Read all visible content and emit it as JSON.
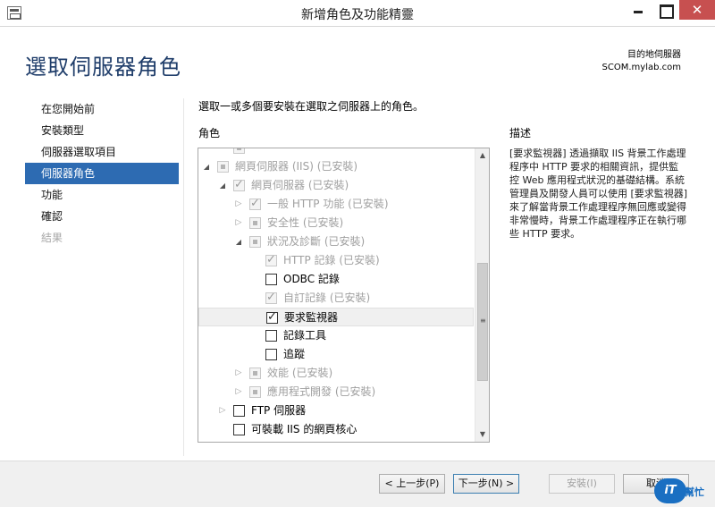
{
  "window": {
    "title": "新增角色及功能精靈",
    "close_glyph": "✕"
  },
  "header": {
    "title": "選取伺服器角色",
    "destination_label": "目的地伺服器",
    "destination_server": "SCOM.mylab.com"
  },
  "nav": {
    "items": [
      {
        "label": "在您開始前",
        "state": "normal"
      },
      {
        "label": "安裝類型",
        "state": "normal"
      },
      {
        "label": "伺服器選取項目",
        "state": "normal"
      },
      {
        "label": "伺服器角色",
        "state": "active"
      },
      {
        "label": "功能",
        "state": "normal"
      },
      {
        "label": "確認",
        "state": "normal"
      },
      {
        "label": "結果",
        "state": "disabled"
      }
    ]
  },
  "main": {
    "instruction": "選取一或多個要安裝在選取之伺服器上的角色。",
    "roles_header": "角色",
    "description_header": "描述",
    "description": "[要求監視器] 透過擷取 IIS 背景工作處理程序中 HTTP 要求的相關資訊，提供監控 Web 應用程式狀況的基礎結構。系統管理員及開發人員可以使用 [要求監視器] 來了解當背景工作處理程序無回應或變得非常慢時，背景工作處理程序正在執行哪些 HTTP 要求。"
  },
  "tree": {
    "rows": [
      {
        "label": "",
        "indent": 1,
        "expander": "none",
        "check": "partial",
        "disabled": true
      },
      {
        "label": "網頁伺服器 (IIS) (已安裝)",
        "indent": 0,
        "expander": "expanded",
        "check": "partial",
        "disabled": true
      },
      {
        "label": "網頁伺服器 (已安裝)",
        "indent": 1,
        "expander": "expanded",
        "check": "checked",
        "disabled": true
      },
      {
        "label": "一般 HTTP 功能 (已安裝)",
        "indent": 2,
        "expander": "collapsed",
        "check": "checked",
        "disabled": true
      },
      {
        "label": "安全性 (已安裝)",
        "indent": 2,
        "expander": "collapsed",
        "check": "partial",
        "disabled": true
      },
      {
        "label": "狀況及診斷 (已安裝)",
        "indent": 2,
        "expander": "expanded",
        "check": "partial",
        "disabled": true
      },
      {
        "label": "HTTP 記錄 (已安裝)",
        "indent": 3,
        "expander": "none",
        "check": "checked",
        "disabled": true
      },
      {
        "label": "ODBC 記錄",
        "indent": 3,
        "expander": "none",
        "check": "unchecked",
        "disabled": false
      },
      {
        "label": "自訂記錄 (已安裝)",
        "indent": 3,
        "expander": "none",
        "check": "checked",
        "disabled": true
      },
      {
        "label": "要求監視器",
        "indent": 3,
        "expander": "none",
        "check": "checked",
        "disabled": false,
        "selected": true
      },
      {
        "label": "記錄工具",
        "indent": 3,
        "expander": "none",
        "check": "unchecked",
        "disabled": false
      },
      {
        "label": "追蹤",
        "indent": 3,
        "expander": "none",
        "check": "unchecked",
        "disabled": false
      },
      {
        "label": "效能 (已安裝)",
        "indent": 2,
        "expander": "collapsed",
        "check": "partial",
        "disabled": true
      },
      {
        "label": "應用程式開發 (已安裝)",
        "indent": 2,
        "expander": "collapsed",
        "check": "partial",
        "disabled": true
      },
      {
        "label": "FTP 伺服器",
        "indent": 1,
        "expander": "collapsed",
        "check": "unchecked",
        "disabled": false
      },
      {
        "label": "可裝載 IIS 的網頁核心",
        "indent": 1,
        "expander": "none",
        "check": "unchecked",
        "disabled": false
      }
    ],
    "scroll_grip": "≡"
  },
  "footer": {
    "prev": "< 上一步(P)",
    "next": "下一步(N) >",
    "install": "安裝(I)",
    "cancel": "取消"
  },
  "watermark": {
    "logo": "iT",
    "text": "幫忙"
  }
}
